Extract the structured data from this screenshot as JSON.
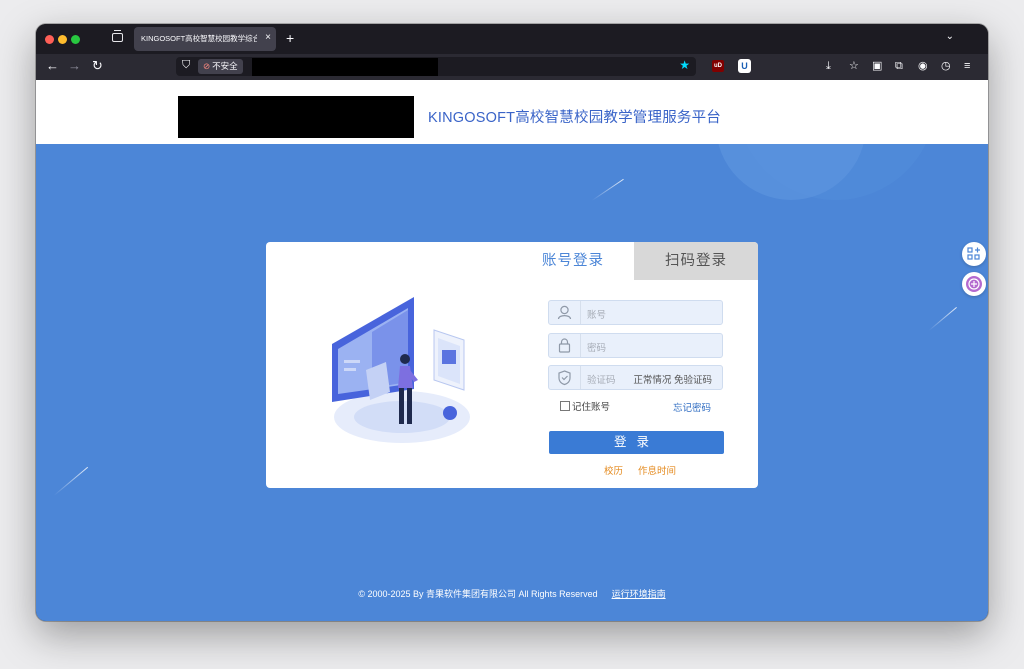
{
  "browser": {
    "tab_title": "KINGOSOFT高校智慧校园教学综合服",
    "tab_close": "×",
    "new_tab": "+",
    "tab_menu": "⌄",
    "insecure_label": "不安全",
    "ext_ublock": "uD"
  },
  "page": {
    "site_title": "KINGOSOFT高校智慧校园教学管理服务平台",
    "tabs": {
      "account": "账号登录",
      "qr": "扫码登录"
    },
    "fields": {
      "account_placeholder": "账号",
      "password_placeholder": "密码",
      "captcha_placeholder": "验证码",
      "captcha_hint": "正常情况 免验证码"
    },
    "remember_label": "记住账号",
    "forgot_label": "忘记密码",
    "login_button": "登录",
    "links": {
      "calendar": "校历",
      "schedule": "作息时间"
    },
    "footer": {
      "copyright": "© 2000-2025 By 青果软件集团有限公司 All Rights Reserved",
      "guide": "运行环境指南"
    }
  },
  "colors": {
    "brand_blue": "#4c86d7",
    "button_blue": "#3a7bd5",
    "link_orange": "#e48a1e"
  }
}
